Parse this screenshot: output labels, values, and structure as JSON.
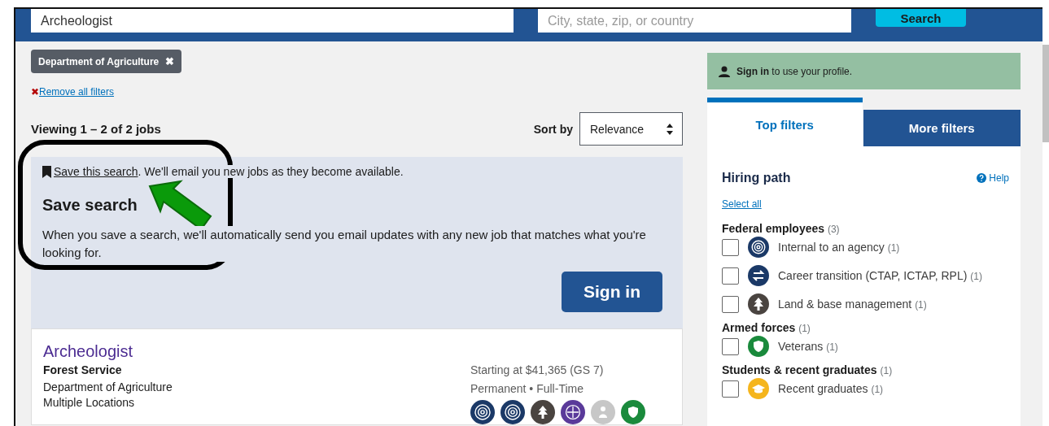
{
  "search": {
    "keyword": "Archeologist",
    "location_placeholder": "City, state, zip, or country",
    "button": "Search"
  },
  "active_filters": [
    {
      "label": "Department of Agriculture",
      "remove": "✖"
    }
  ],
  "remove_all": {
    "icon": "✖",
    "label": "Remove all filters"
  },
  "results": {
    "count": "Viewing 1 – 2 of 2 jobs",
    "sort_label": "Sort by",
    "sort_value": "Relevance"
  },
  "save_search": {
    "link": "Save this search",
    "text": ". We'll email you new jobs as they become available.",
    "title": "Save search",
    "body": "When you save a search, we'll automatically send you email updates with any new job that matches what you're looking for.",
    "button": "Sign in"
  },
  "jobs": [
    {
      "title": "Archeologist",
      "agency": "Forest Service",
      "department": "Department of Agriculture",
      "location": "Multiple Locations",
      "salary": "Starting at $41,365 (GS 7)",
      "schedule": "Permanent • Full-Time",
      "paths": [
        {
          "kind": "target",
          "color": "#1b3967"
        },
        {
          "kind": "target",
          "color": "#1b3967"
        },
        {
          "kind": "tree",
          "color": "#4a4440"
        },
        {
          "kind": "globe",
          "color": "#5a3a9a"
        },
        {
          "kind": "person",
          "color": "#c7c7c7"
        },
        {
          "kind": "shield",
          "color": "#1a8a3c"
        }
      ]
    }
  ],
  "profile_banner": {
    "bold": "Sign in",
    "text": "to use your profile."
  },
  "tabs": [
    {
      "label": "Top filters",
      "selected": true
    },
    {
      "label": "More filters",
      "selected": false
    }
  ],
  "hiring_path": {
    "title": "Hiring path",
    "help": "Help",
    "select_all": "Select all",
    "groups": [
      {
        "label": "Federal employees",
        "count": "(3)",
        "items": [
          {
            "label": "Internal to an agency",
            "count": "(1)",
            "kind": "target",
            "color": "#1b3967",
            "checked": false
          },
          {
            "label": "Career transition (CTAP, ICTAP, RPL)",
            "count": "(1)",
            "kind": "swap",
            "color": "#1b3967",
            "checked": false
          },
          {
            "label": "Land & base management",
            "count": "(1)",
            "kind": "tree",
            "color": "#4a4440",
            "checked": false
          }
        ]
      },
      {
        "label": "Armed forces",
        "count": "(1)",
        "items": [
          {
            "label": "Veterans",
            "count": "(1)",
            "kind": "shield",
            "color": "#1a8a3c",
            "checked": false
          }
        ]
      },
      {
        "label": "Students & recent graduates",
        "count": "(1)",
        "items": [
          {
            "label": "Recent graduates",
            "count": "(1)",
            "kind": "cap",
            "color": "#f5b51c",
            "checked": false
          }
        ]
      }
    ]
  }
}
